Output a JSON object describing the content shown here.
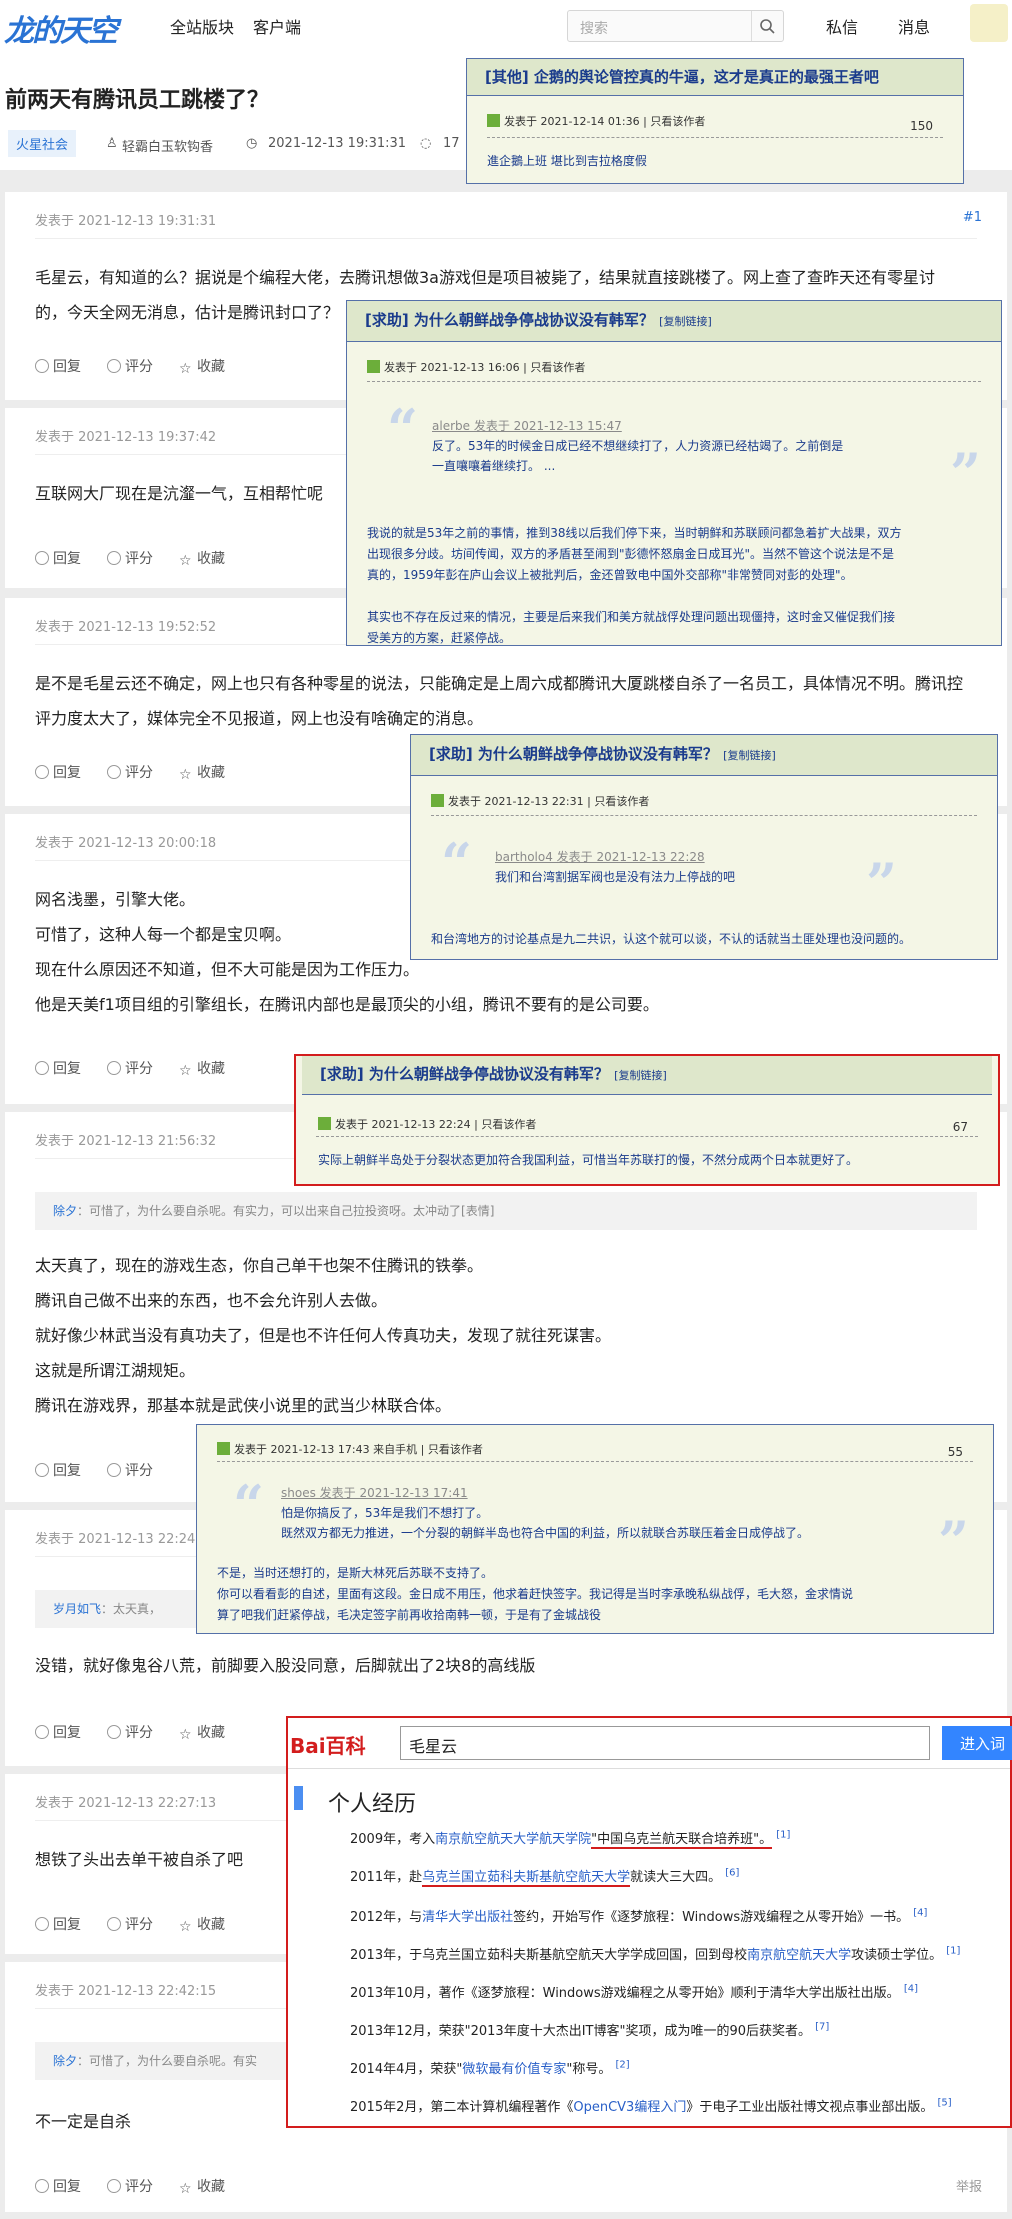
{
  "site": {
    "logo": "龙的天空",
    "nav": [
      "全站版块",
      "客户端"
    ],
    "search_placeholder": "搜索",
    "right_nav": [
      "私信",
      "消息"
    ]
  },
  "thread": {
    "title": "前两天有腾讯员工跳楼了？",
    "tag": "火星社会",
    "author": "轻霸白玉软钩香",
    "time": "2021-12-13 19:31:31",
    "comments": "17"
  },
  "posts": [
    {
      "time": "发表于 2021-12-13 19:31:31",
      "num": "#1",
      "lines": [
        "毛星云，有知道的么？据说是个编程大佬，去腾讯想做3a游戏但是项目被毙了，结果就直接跳楼了。网上查了查昨天还有零星讨",
        "的，今天全网无消息，估计是腾讯封口了？"
      ]
    },
    {
      "time": "发表于 2021-12-13 19:37:42",
      "lines": [
        "互联网大厂现在是沆瀣一气，互相帮忙呢"
      ]
    },
    {
      "time": "发表于 2021-12-13 19:52:52",
      "lines": [
        "是不是毛星云还不确定，网上也只有各种零星的说法，只能确定是上周六成都腾讯大厦跳楼自杀了一名员工，具体情况不明。腾讯控",
        "评力度太大了，媒体完全不见报道，网上也没有啥确定的消息。"
      ]
    },
    {
      "time": "发表于 2021-12-13 20:00:18",
      "lines": [
        "网名浅墨，引擎大佬。",
        "可惜了，这种人每一个都是宝贝啊。",
        "现在什么原因还不知道，但不大可能是因为工作压力。",
        "他是天美f1项目组的引擎组长，在腾讯内部也是最顶尖的小组，腾讯不要有的是公司要。"
      ]
    },
    {
      "time": "发表于 2021-12-13 21:56:32",
      "quote_user": "除夕",
      "quote_text": "：可惜了，为什么要自杀呢。有实力，可以出来自己拉投资呀。太冲动了[表情]",
      "lines": [
        "太天真了，现在的游戏生态，你自己单干也架不住腾讯的铁拳。",
        "腾讯自己做不出来的东西，也不会允许别人去做。",
        "就好像少林武当没有真功夫了，但是也不许任何人传真功夫，发现了就往死谋害。",
        "这就是所谓江湖规矩。",
        "腾讯在游戏界，那基本就是武侠小说里的武当少林联合体。"
      ]
    },
    {
      "time": "发表于 2021-12-13 22:24:",
      "quote_user": "岁月如飞",
      "quote_text": "：太天真，",
      "lines": [
        "没错，就好像鬼谷八荒，前脚要入股没同意，后脚就出了2块8的高线版"
      ]
    },
    {
      "time": "发表于 2021-12-13 22:27:13",
      "lines": [
        "想铁了头出去单干被自杀了吧"
      ]
    },
    {
      "time": "发表于 2021-12-13 22:42:15",
      "quote_user": "除夕",
      "quote_text": "：可惜了，为什么要自杀呢。有实",
      "lines": [
        "不一定是自杀"
      ],
      "report": "举报"
    }
  ],
  "actions": {
    "reply": "回复",
    "rate": "评分",
    "fav": "收藏"
  },
  "cards": [
    {
      "title": "[其他] 企鹅的舆论管控真的牛逼，这才是真正的最强王者吧",
      "meta": "发表于 2021-12-14 01:36",
      "only": "只看该作者",
      "num": "150",
      "body": "進企鵝上班 堪比到吉拉格度假"
    },
    {
      "title": "[求助] 为什么朝鲜战争停战协议没有韩军？",
      "copy": "[复制链接]",
      "meta": "发表于 2021-12-13 16:06",
      "only": "只看该作者",
      "q_author": "alerbe 发表于 2021-12-13 15:47",
      "q_text": [
        "反了。53年的时候金日成已经不想继续打了，人力资源已经枯竭了。之前倒是",
        "一直嚷嚷着继续打。 ..."
      ],
      "body": [
        "我说的就是53年之前的事情，推到38线以后我们停下来，当时朝鲜和苏联顾问都急着扩大战果，双方",
        "出现很多分歧。坊间传闻，双方的矛盾甚至闹到\"彭德怀怒扇金日成耳光\"。当然不管这个说法是不是",
        "真的，1959年彭在庐山会议上被批判后，金还曾致电中国外交部称\"非常赞同对彭的处理\"。",
        "",
        "其实也不存在反过来的情况，主要是后来我们和美方就战俘处理问题出现僵持，这时金又催促我们接",
        "受美方的方案，赶紧停战。"
      ]
    },
    {
      "title": "[求助] 为什么朝鲜战争停战协议没有韩军？",
      "copy": "[复制链接]",
      "meta": "发表于 2021-12-13 22:31",
      "only": "只看该作者",
      "q_author": "bartholo4 发表于 2021-12-13 22:28",
      "q_text": [
        "我们和台湾割据军阀也是没有法力上停战的吧"
      ],
      "body": [
        "和台湾地方的讨论基点是九二共识，认这个就可以谈，不认的话就当土匪处理也没问题的。"
      ]
    },
    {
      "title": "[求助] 为什么朝鲜战争停战协议没有韩军？",
      "copy": "[复制链接]",
      "meta": "发表于 2021-12-13 22:24",
      "only": "只看该作者",
      "num": "67",
      "body": [
        "实际上朝鲜半岛处于分裂状态更加符合我国利益，可惜当年苏联打的慢，不然分成两个日本就更好了。"
      ]
    },
    {
      "meta": "发表于 2021-12-13 17:43 来自手机",
      "only": "只看该作者",
      "num": "55",
      "q_author": "shoes 发表于 2021-12-13 17:41",
      "q_text": [
        "怕是你搞反了，53年是我们不想打了。",
        "既然双方都无力推进，一个分裂的朝鲜半岛也符合中国的利益，所以就联合苏联压着金日成停战了。"
      ],
      "body": [
        "不是，当时还想打的，是斯大林死后苏联不支持了。",
        "你可以看看彭的自述，里面有这段。金日成不用压，他求着赶快签字。我记得是当时李承晚私纵战俘，毛大怒，金求情说",
        "算了吧我们赶紧停战，毛决定签字前再收拾南韩一顿，于是有了金城战役"
      ]
    }
  ],
  "baidu": {
    "logo": "Bai百科",
    "query": "毛星云",
    "button": "进入词",
    "section": "个人经历",
    "items": [
      {
        "pre": "2009年，考入",
        "link": "南京航空航天大学航天学院",
        "mid": "\"中国乌克兰航天联合培养班\"。",
        "ref": "[1]"
      },
      {
        "pre": "2011年，赴",
        "link": "乌克兰国立茹科夫斯基航空航天大学",
        "mid": "就读大三大四。",
        "ref": "[6]"
      },
      {
        "pre": "2012年，与",
        "link": "清华大学出版社",
        "mid": "签约，开始写作《逐梦旅程：Windows游戏编程之从零开始》一书。",
        "ref": "[4]"
      },
      {
        "pre": "2013年，于乌克兰国立茹科夫斯基航空航天大学学成回国，回到母校",
        "link": "南京航空航天大学",
        "mid": "攻读硕士学位。",
        "ref": "[1]"
      },
      {
        "pre": "2013年10月，著作《逐梦旅程：Windows游戏编程之从零开始》顺利于清华大学出版社出版。",
        "link": "",
        "mid": "",
        "ref": "[4]"
      },
      {
        "pre": "2013年12月，荣获\"2013年度十大杰出IT博客\"奖项，成为唯一的90后获奖者。",
        "link": "",
        "mid": "",
        "ref": "[7]"
      },
      {
        "pre": "2014年4月，荣获\"",
        "link": "微软最有价值专家",
        "mid": "\"称号。",
        "ref": "[2]"
      },
      {
        "pre": "2015年2月，第二本计算机编程著作《",
        "link": "OpenCV3编程入门",
        "mid": "》于电子工业出版社博文视点事业部出版。",
        "ref": "[5]"
      }
    ]
  }
}
